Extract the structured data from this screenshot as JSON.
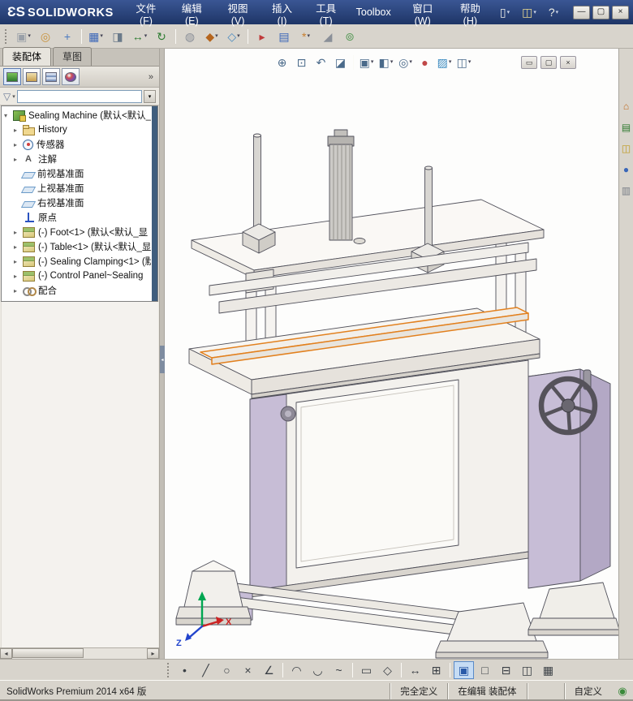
{
  "colors": {
    "titlebar-top": "#3A5694",
    "titlebar-bottom": "#1E3566",
    "toolbar-bg": "#D8D4CC",
    "panel-bg": "#ECE9E2",
    "viewport-bg": "#FDFDFC",
    "accent-orange": "#E2801E",
    "lavender-light": "#D9D2E2",
    "lavender-mid": "#C7BDD6",
    "lavender-dark": "#B3A8C5",
    "edge": "#50505A",
    "tree-scrollbar": "#3F5D7D",
    "selection-blue": "#2A5AA8"
  },
  "window": {
    "brand_mark": "ƐS",
    "brand_name": "SOLIDWORKS",
    "controls": [
      {
        "name": "minimize-button",
        "glyph": "—"
      },
      {
        "name": "maximize-button",
        "glyph": "▢"
      },
      {
        "name": "close-button",
        "glyph": "×"
      }
    ]
  },
  "menu_bar": {
    "items": [
      {
        "name": "menu-file",
        "label": "文件(F)"
      },
      {
        "name": "menu-edit",
        "label": "编辑(E)"
      },
      {
        "name": "menu-view",
        "label": "视图(V)"
      },
      {
        "name": "menu-insert",
        "label": "插入(I)"
      },
      {
        "name": "menu-tools",
        "label": "工具(T)"
      },
      {
        "name": "menu-toolbox",
        "label": "Toolbox"
      },
      {
        "name": "menu-window",
        "label": "窗口(W)"
      },
      {
        "name": "menu-help",
        "label": "帮助(H)"
      }
    ]
  },
  "title_quick_toolbar": {
    "items": [
      {
        "name": "new-document-button",
        "glyph": "▯",
        "color": "#F0F0E8",
        "dropdown": true
      },
      {
        "name": "open-button",
        "glyph": "◫",
        "color": "#E8D890",
        "dropdown": true
      },
      {
        "name": "help-button",
        "glyph": "?",
        "color": "#F0F0E8",
        "dropdown": true
      }
    ]
  },
  "assembly_toolbar": {
    "items": [
      {
        "name": "insert-components-button",
        "glyph": "▣",
        "color": "#9AA0A8",
        "dropdown": true
      },
      {
        "name": "mate-button",
        "glyph": "◎",
        "color": "#C8913A"
      },
      {
        "name": "smart-fasteners-button",
        "glyph": "+",
        "color": "#4A7AC0"
      },
      {
        "type": "sep"
      },
      {
        "name": "linear-component-pattern-button",
        "glyph": "▦",
        "color": "#3A66B8",
        "dropdown": true
      },
      {
        "name": "component-preview-button",
        "glyph": "◨",
        "color": "#6A7A8A"
      },
      {
        "name": "move-component-button",
        "glyph": "↔",
        "color": "#2E7D32",
        "dropdown": true
      },
      {
        "name": "rotate-component-button",
        "glyph": "↻",
        "color": "#2E7D32"
      },
      {
        "type": "sep"
      },
      {
        "name": "show-hidden-components-button",
        "glyph": "◍",
        "color": "#8A8F98"
      },
      {
        "name": "assembly-features-button",
        "glyph": "◆",
        "color": "#B5651D",
        "dropdown": true
      },
      {
        "name": "reference-geometry-button",
        "glyph": "◇",
        "color": "#4A8AC0",
        "dropdown": true
      },
      {
        "type": "sep"
      },
      {
        "name": "new-motion-study-button",
        "glyph": "▸",
        "color": "#C03A3A"
      },
      {
        "name": "bill-of-materials-button",
        "glyph": "▤",
        "color": "#3A66B8"
      },
      {
        "name": "exploded-view-button",
        "glyph": "*",
        "color": "#C87C2A",
        "dropdown": true
      },
      {
        "name": "instant3d-button",
        "glyph": "◢",
        "color": "#8A8F98"
      },
      {
        "name": "update-assembly-button",
        "glyph": "⊚",
        "color": "#5A9A5A"
      }
    ]
  },
  "left_panel": {
    "tabs": [
      {
        "label": "装配体",
        "active": true
      },
      {
        "label": "草图",
        "active": false
      }
    ],
    "manager_tabs": [
      "featuremanager-tab",
      "propertymanager-tab",
      "configurationmanager-tab",
      "displaymanager-tab"
    ],
    "overflow_chevron": "»",
    "filter": {
      "funnel_glyph": "▽",
      "dropdown_glyph": "▾",
      "value": ""
    },
    "hscroll": {
      "left_arrow": "◂",
      "right_arrow": "▸"
    },
    "tree": [
      {
        "label": "Sealing Machine (默认<默认_显",
        "icon": "assembly-icon",
        "expander": "▾"
      },
      {
        "label": "History",
        "icon": "history-folder-icon",
        "expander": "▸"
      },
      {
        "label": "传感器",
        "icon": "sensors-icon",
        "expander": "▸"
      },
      {
        "label": "注解",
        "icon": "annotations-icon",
        "expander": "▸"
      },
      {
        "label": "前视基准面",
        "icon": "plane-icon"
      },
      {
        "label": "上视基准面",
        "icon": "plane-icon"
      },
      {
        "label": "右视基准面",
        "icon": "plane-icon"
      },
      {
        "label": "原点",
        "icon": "origin-icon"
      },
      {
        "label": "(-) Foot<1> (默认<默认_显",
        "icon": "component-icon",
        "expander": "▸"
      },
      {
        "label": "(-) Table<1> (默认<默认_显",
        "icon": "component-icon",
        "expander": "▸"
      },
      {
        "label": "(-) Sealing Clamping<1> (默",
        "icon": "component-icon",
        "expander": "▸"
      },
      {
        "label": "(-) Control Panel~Sealing",
        "icon": "component-icon",
        "expander": "▸"
      },
      {
        "label": "配合",
        "icon": "mates-icon",
        "expander": "▸"
      }
    ]
  },
  "splitter": {
    "collapse_glyph": "◂"
  },
  "viewport": {
    "heads_up": {
      "items": [
        {
          "name": "zoom-to-fit-button",
          "glyph": "⊕",
          "color": "#4A6A8A"
        },
        {
          "name": "zoom-to-area-button",
          "glyph": "⊡",
          "color": "#4A6A8A"
        },
        {
          "name": "previous-view-button",
          "glyph": "↶",
          "color": "#4A6A8A"
        },
        {
          "name": "section-view-button",
          "glyph": "◪",
          "color": "#4A6A8A"
        },
        {
          "type": "sep"
        },
        {
          "name": "view-orientation-button",
          "glyph": "▣",
          "color": "#4A6A8A",
          "dropdown": true
        },
        {
          "name": "display-style-button",
          "glyph": "◧",
          "color": "#4A6A8A",
          "dropdown": true
        },
        {
          "name": "hide-show-items-button",
          "glyph": "◎",
          "color": "#4A6A8A",
          "dropdown": true
        },
        {
          "name": "edit-appearance-button",
          "glyph": "●",
          "color": "#C04848"
        },
        {
          "name": "apply-scene-button",
          "glyph": "▨",
          "color": "#3A8AC0",
          "dropdown": true
        },
        {
          "name": "view-settings-button",
          "glyph": "◫",
          "color": "#4A6A8A",
          "dropdown": true
        }
      ]
    },
    "document_controls": [
      {
        "name": "document-minimize-button",
        "glyph": "▭"
      },
      {
        "name": "document-restore-button",
        "glyph": "▢"
      },
      {
        "name": "document-close-button",
        "glyph": "×"
      }
    ],
    "triad": {
      "x_label": "X",
      "z_label": "Z"
    }
  },
  "task_pane": {
    "items": [
      {
        "name": "task-pane-resources-tab",
        "glyph": "⌂",
        "color": "#C06A20"
      },
      {
        "name": "task-pane-design-library-tab",
        "glyph": "▤",
        "color": "#2F7A2F"
      },
      {
        "name": "task-pane-file-explorer-tab",
        "glyph": "◫",
        "color": "#C09A20"
      },
      {
        "name": "task-pane-appearances-tab",
        "glyph": "●",
        "color": "#3A66B8"
      },
      {
        "name": "task-pane-custom-properties-tab",
        "glyph": "▥",
        "color": "#7A7F88"
      }
    ]
  },
  "sketch_toolbar": {
    "items": [
      {
        "name": "sketch-point-button",
        "glyph": "•"
      },
      {
        "name": "sketch-line-button",
        "glyph": "╱"
      },
      {
        "name": "sketch-circle-button",
        "glyph": "○"
      },
      {
        "name": "sketch-trim-button",
        "glyph": "×"
      },
      {
        "name": "sketch-chamfer-button",
        "glyph": "∠"
      },
      {
        "type": "sep"
      },
      {
        "name": "sketch-arc-button",
        "glyph": "◠"
      },
      {
        "name": "sketch-tangent-arc-button",
        "glyph": "◡"
      },
      {
        "name": "sketch-spline-button",
        "glyph": "~"
      },
      {
        "type": "sep"
      },
      {
        "name": "sketch-rectangle-button",
        "glyph": "▭"
      },
      {
        "name": "sketch-polygon-button",
        "glyph": "◇"
      },
      {
        "type": "sep"
      },
      {
        "name": "smart-dimension-button",
        "glyph": "↔"
      },
      {
        "name": "grid-snap-button",
        "glyph": "⊞"
      },
      {
        "type": "sep"
      },
      {
        "name": "shaded-sketch-planes-button",
        "glyph": "▣",
        "color": "#2A5AA8",
        "active": true
      },
      {
        "name": "viewport-single-button",
        "glyph": "□"
      },
      {
        "name": "viewport-two-horizontal-button",
        "glyph": "⊟"
      },
      {
        "name": "viewport-two-vertical-button",
        "glyph": "◫"
      },
      {
        "name": "viewport-four-button",
        "glyph": "▦"
      }
    ]
  },
  "status_bar": {
    "product": "SolidWorks Premium 2014 x64 版",
    "definition_status": "完全定义",
    "editing_status": "在编辑 装配体",
    "custom_label": "自定义",
    "quick_tips_glyph": "◉"
  }
}
